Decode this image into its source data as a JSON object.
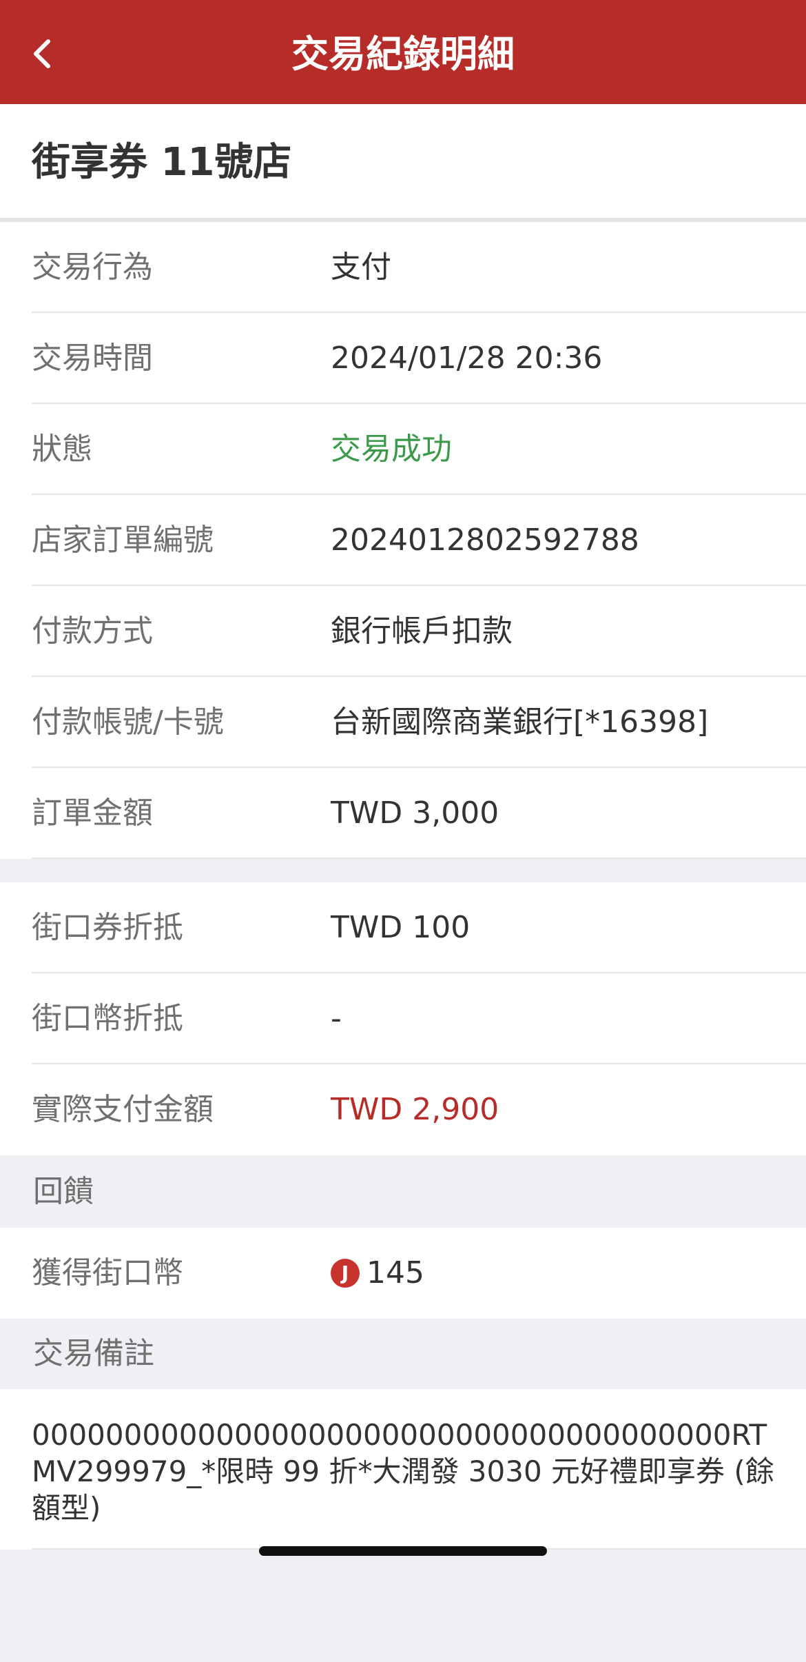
{
  "header": {
    "title": "交易紀錄明細"
  },
  "merchant": {
    "name": "街享券 11號店"
  },
  "details": [
    {
      "label": "交易行為",
      "value": "支付"
    },
    {
      "label": "交易時間",
      "value": "2024/01/28 20:36"
    },
    {
      "label": "狀態",
      "value": "交易成功"
    },
    {
      "label": "店家訂單編號",
      "value": "2024012802592788"
    },
    {
      "label": "付款方式",
      "value": "銀行帳戶扣款"
    },
    {
      "label": "付款帳號/卡號",
      "value": "台新國際商業銀行[*16398]"
    },
    {
      "label": "訂單金額",
      "value": "TWD 3,000"
    }
  ],
  "payment": [
    {
      "label": "街口券折抵",
      "value": "TWD 100"
    },
    {
      "label": "街口幣折抵",
      "value": "-"
    },
    {
      "label": "實際支付金額",
      "value": "TWD 2,900"
    }
  ],
  "reward": {
    "section_title": "回饋",
    "label": "獲得街口幣",
    "coin_symbol": "J",
    "value": "145"
  },
  "note": {
    "section_title": "交易備註",
    "text": "00000000000000000000000000000000000000RTMV299979_*限時 99 折*大潤發 3030 元好禮即享券 (餘額型)"
  },
  "colors": {
    "brand": "#b52c28",
    "success": "#3a9a4a",
    "amount": "#b52c28"
  },
  "icons": {
    "back": "chevron-left-icon",
    "coin": "jko-coin-icon"
  }
}
